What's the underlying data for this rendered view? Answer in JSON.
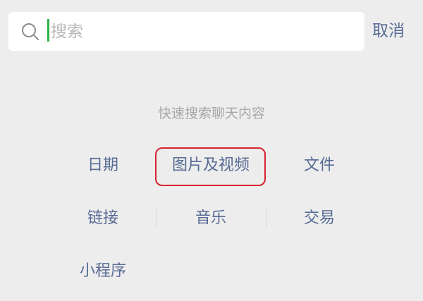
{
  "search": {
    "placeholder": "搜索",
    "value": "",
    "cancel_label": "取消"
  },
  "hint": "快速搜索聊天内容",
  "options": [
    {
      "label": "日期"
    },
    {
      "label": "图片及视频"
    },
    {
      "label": "文件"
    },
    {
      "label": "链接"
    },
    {
      "label": "音乐"
    },
    {
      "label": "交易"
    },
    {
      "label": "小程序"
    }
  ],
  "icons": {
    "search": "search-icon"
  },
  "colors": {
    "background": "#ededed",
    "link": "#576b95",
    "hint": "#a7a7a7",
    "cursor": "#2bb34a",
    "highlight": "#d6232f"
  }
}
